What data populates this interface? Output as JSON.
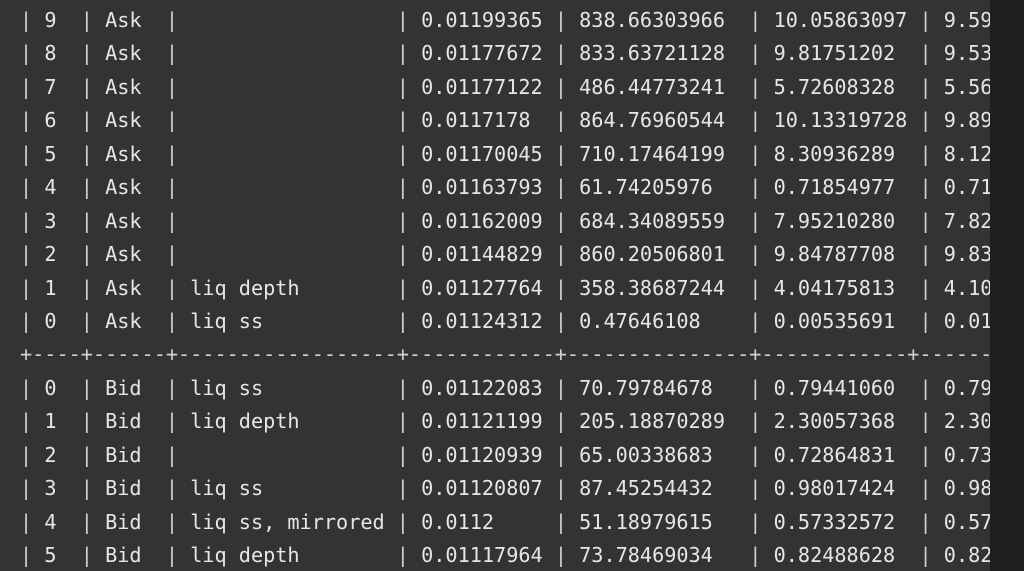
{
  "order_book": {
    "ask_rows": [
      {
        "level": "9",
        "side": "Ask",
        "tag": "",
        "price": "0.01199365",
        "quantity": "838.66303966",
        "value": "10.05863097",
        "total": "9.59"
      },
      {
        "level": "8",
        "side": "Ask",
        "tag": "",
        "price": "0.01177672",
        "quantity": "833.63721128",
        "value": "9.81751202",
        "total": "9.53"
      },
      {
        "level": "7",
        "side": "Ask",
        "tag": "",
        "price": "0.01177122",
        "quantity": "486.44773241",
        "value": "5.72608328",
        "total": "5.56"
      },
      {
        "level": "6",
        "side": "Ask",
        "tag": "",
        "price": "0.0117178",
        "quantity": "864.76960544",
        "value": "10.13319728",
        "total": "9.89"
      },
      {
        "level": "5",
        "side": "Ask",
        "tag": "",
        "price": "0.01170045",
        "quantity": "710.17464199",
        "value": "8.30936289",
        "total": "8.12"
      },
      {
        "level": "4",
        "side": "Ask",
        "tag": "",
        "price": "0.01163793",
        "quantity": "61.74205976",
        "value": "0.71854977",
        "total": "0.71"
      },
      {
        "level": "3",
        "side": "Ask",
        "tag": "",
        "price": "0.01162009",
        "quantity": "684.34089559",
        "value": "7.95210280",
        "total": "7.82"
      },
      {
        "level": "2",
        "side": "Ask",
        "tag": "",
        "price": "0.01144829",
        "quantity": "860.20506801",
        "value": "9.84787708",
        "total": "9.83"
      },
      {
        "level": "1",
        "side": "Ask",
        "tag": "liq depth",
        "price": "0.01127764",
        "quantity": "358.38687244",
        "value": "4.04175813",
        "total": "4.10"
      },
      {
        "level": "0",
        "side": "Ask",
        "tag": "liq ss",
        "price": "0.01124312",
        "quantity": "0.47646108",
        "value": "0.00535691",
        "total": "0.01"
      }
    ],
    "separator": "+----+------+------------------+------------+---------------+------------+--------",
    "bid_rows": [
      {
        "level": "0",
        "side": "Bid",
        "tag": "liq ss",
        "price": "0.01122083",
        "quantity": "70.79784678",
        "value": "0.79441060",
        "total": "0.79"
      },
      {
        "level": "1",
        "side": "Bid",
        "tag": "liq depth",
        "price": "0.01121199",
        "quantity": "205.18870289",
        "value": "2.30057368",
        "total": "2.30"
      },
      {
        "level": "2",
        "side": "Bid",
        "tag": "",
        "price": "0.01120939",
        "quantity": "65.00338683",
        "value": "0.72864831",
        "total": "0.73"
      },
      {
        "level": "3",
        "side": "Bid",
        "tag": "liq ss",
        "price": "0.01120807",
        "quantity": "87.45254432",
        "value": "0.98017424",
        "total": "0.98"
      },
      {
        "level": "4",
        "side": "Bid",
        "tag": "liq ss, mirrored",
        "price": "0.0112",
        "quantity": "51.18979615",
        "value": "0.57332572",
        "total": "0.57"
      },
      {
        "level": "5",
        "side": "Bid",
        "tag": "liq depth",
        "price": "0.01117964",
        "quantity": "73.78469034",
        "value": "0.82488628",
        "total": "0.82"
      }
    ]
  }
}
